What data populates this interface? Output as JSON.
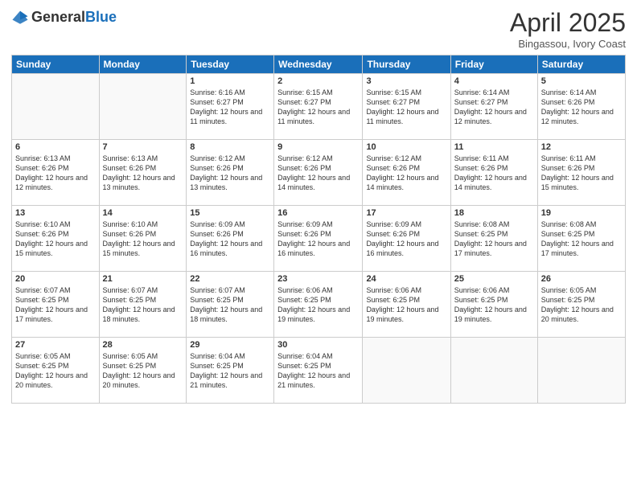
{
  "header": {
    "logo_general": "General",
    "logo_blue": "Blue",
    "month_title": "April 2025",
    "subtitle": "Bingassou, Ivory Coast"
  },
  "days_of_week": [
    "Sunday",
    "Monday",
    "Tuesday",
    "Wednesday",
    "Thursday",
    "Friday",
    "Saturday"
  ],
  "weeks": [
    [
      {
        "day": "",
        "info": ""
      },
      {
        "day": "",
        "info": ""
      },
      {
        "day": "1",
        "info": "Sunrise: 6:16 AM\nSunset: 6:27 PM\nDaylight: 12 hours and 11 minutes."
      },
      {
        "day": "2",
        "info": "Sunrise: 6:15 AM\nSunset: 6:27 PM\nDaylight: 12 hours and 11 minutes."
      },
      {
        "day": "3",
        "info": "Sunrise: 6:15 AM\nSunset: 6:27 PM\nDaylight: 12 hours and 11 minutes."
      },
      {
        "day": "4",
        "info": "Sunrise: 6:14 AM\nSunset: 6:27 PM\nDaylight: 12 hours and 12 minutes."
      },
      {
        "day": "5",
        "info": "Sunrise: 6:14 AM\nSunset: 6:26 PM\nDaylight: 12 hours and 12 minutes."
      }
    ],
    [
      {
        "day": "6",
        "info": "Sunrise: 6:13 AM\nSunset: 6:26 PM\nDaylight: 12 hours and 12 minutes."
      },
      {
        "day": "7",
        "info": "Sunrise: 6:13 AM\nSunset: 6:26 PM\nDaylight: 12 hours and 13 minutes."
      },
      {
        "day": "8",
        "info": "Sunrise: 6:12 AM\nSunset: 6:26 PM\nDaylight: 12 hours and 13 minutes."
      },
      {
        "day": "9",
        "info": "Sunrise: 6:12 AM\nSunset: 6:26 PM\nDaylight: 12 hours and 14 minutes."
      },
      {
        "day": "10",
        "info": "Sunrise: 6:12 AM\nSunset: 6:26 PM\nDaylight: 12 hours and 14 minutes."
      },
      {
        "day": "11",
        "info": "Sunrise: 6:11 AM\nSunset: 6:26 PM\nDaylight: 12 hours and 14 minutes."
      },
      {
        "day": "12",
        "info": "Sunrise: 6:11 AM\nSunset: 6:26 PM\nDaylight: 12 hours and 15 minutes."
      }
    ],
    [
      {
        "day": "13",
        "info": "Sunrise: 6:10 AM\nSunset: 6:26 PM\nDaylight: 12 hours and 15 minutes."
      },
      {
        "day": "14",
        "info": "Sunrise: 6:10 AM\nSunset: 6:26 PM\nDaylight: 12 hours and 15 minutes."
      },
      {
        "day": "15",
        "info": "Sunrise: 6:09 AM\nSunset: 6:26 PM\nDaylight: 12 hours and 16 minutes."
      },
      {
        "day": "16",
        "info": "Sunrise: 6:09 AM\nSunset: 6:26 PM\nDaylight: 12 hours and 16 minutes."
      },
      {
        "day": "17",
        "info": "Sunrise: 6:09 AM\nSunset: 6:26 PM\nDaylight: 12 hours and 16 minutes."
      },
      {
        "day": "18",
        "info": "Sunrise: 6:08 AM\nSunset: 6:25 PM\nDaylight: 12 hours and 17 minutes."
      },
      {
        "day": "19",
        "info": "Sunrise: 6:08 AM\nSunset: 6:25 PM\nDaylight: 12 hours and 17 minutes."
      }
    ],
    [
      {
        "day": "20",
        "info": "Sunrise: 6:07 AM\nSunset: 6:25 PM\nDaylight: 12 hours and 17 minutes."
      },
      {
        "day": "21",
        "info": "Sunrise: 6:07 AM\nSunset: 6:25 PM\nDaylight: 12 hours and 18 minutes."
      },
      {
        "day": "22",
        "info": "Sunrise: 6:07 AM\nSunset: 6:25 PM\nDaylight: 12 hours and 18 minutes."
      },
      {
        "day": "23",
        "info": "Sunrise: 6:06 AM\nSunset: 6:25 PM\nDaylight: 12 hours and 19 minutes."
      },
      {
        "day": "24",
        "info": "Sunrise: 6:06 AM\nSunset: 6:25 PM\nDaylight: 12 hours and 19 minutes."
      },
      {
        "day": "25",
        "info": "Sunrise: 6:06 AM\nSunset: 6:25 PM\nDaylight: 12 hours and 19 minutes."
      },
      {
        "day": "26",
        "info": "Sunrise: 6:05 AM\nSunset: 6:25 PM\nDaylight: 12 hours and 20 minutes."
      }
    ],
    [
      {
        "day": "27",
        "info": "Sunrise: 6:05 AM\nSunset: 6:25 PM\nDaylight: 12 hours and 20 minutes."
      },
      {
        "day": "28",
        "info": "Sunrise: 6:05 AM\nSunset: 6:25 PM\nDaylight: 12 hours and 20 minutes."
      },
      {
        "day": "29",
        "info": "Sunrise: 6:04 AM\nSunset: 6:25 PM\nDaylight: 12 hours and 21 minutes."
      },
      {
        "day": "30",
        "info": "Sunrise: 6:04 AM\nSunset: 6:25 PM\nDaylight: 12 hours and 21 minutes."
      },
      {
        "day": "",
        "info": ""
      },
      {
        "day": "",
        "info": ""
      },
      {
        "day": "",
        "info": ""
      }
    ]
  ]
}
